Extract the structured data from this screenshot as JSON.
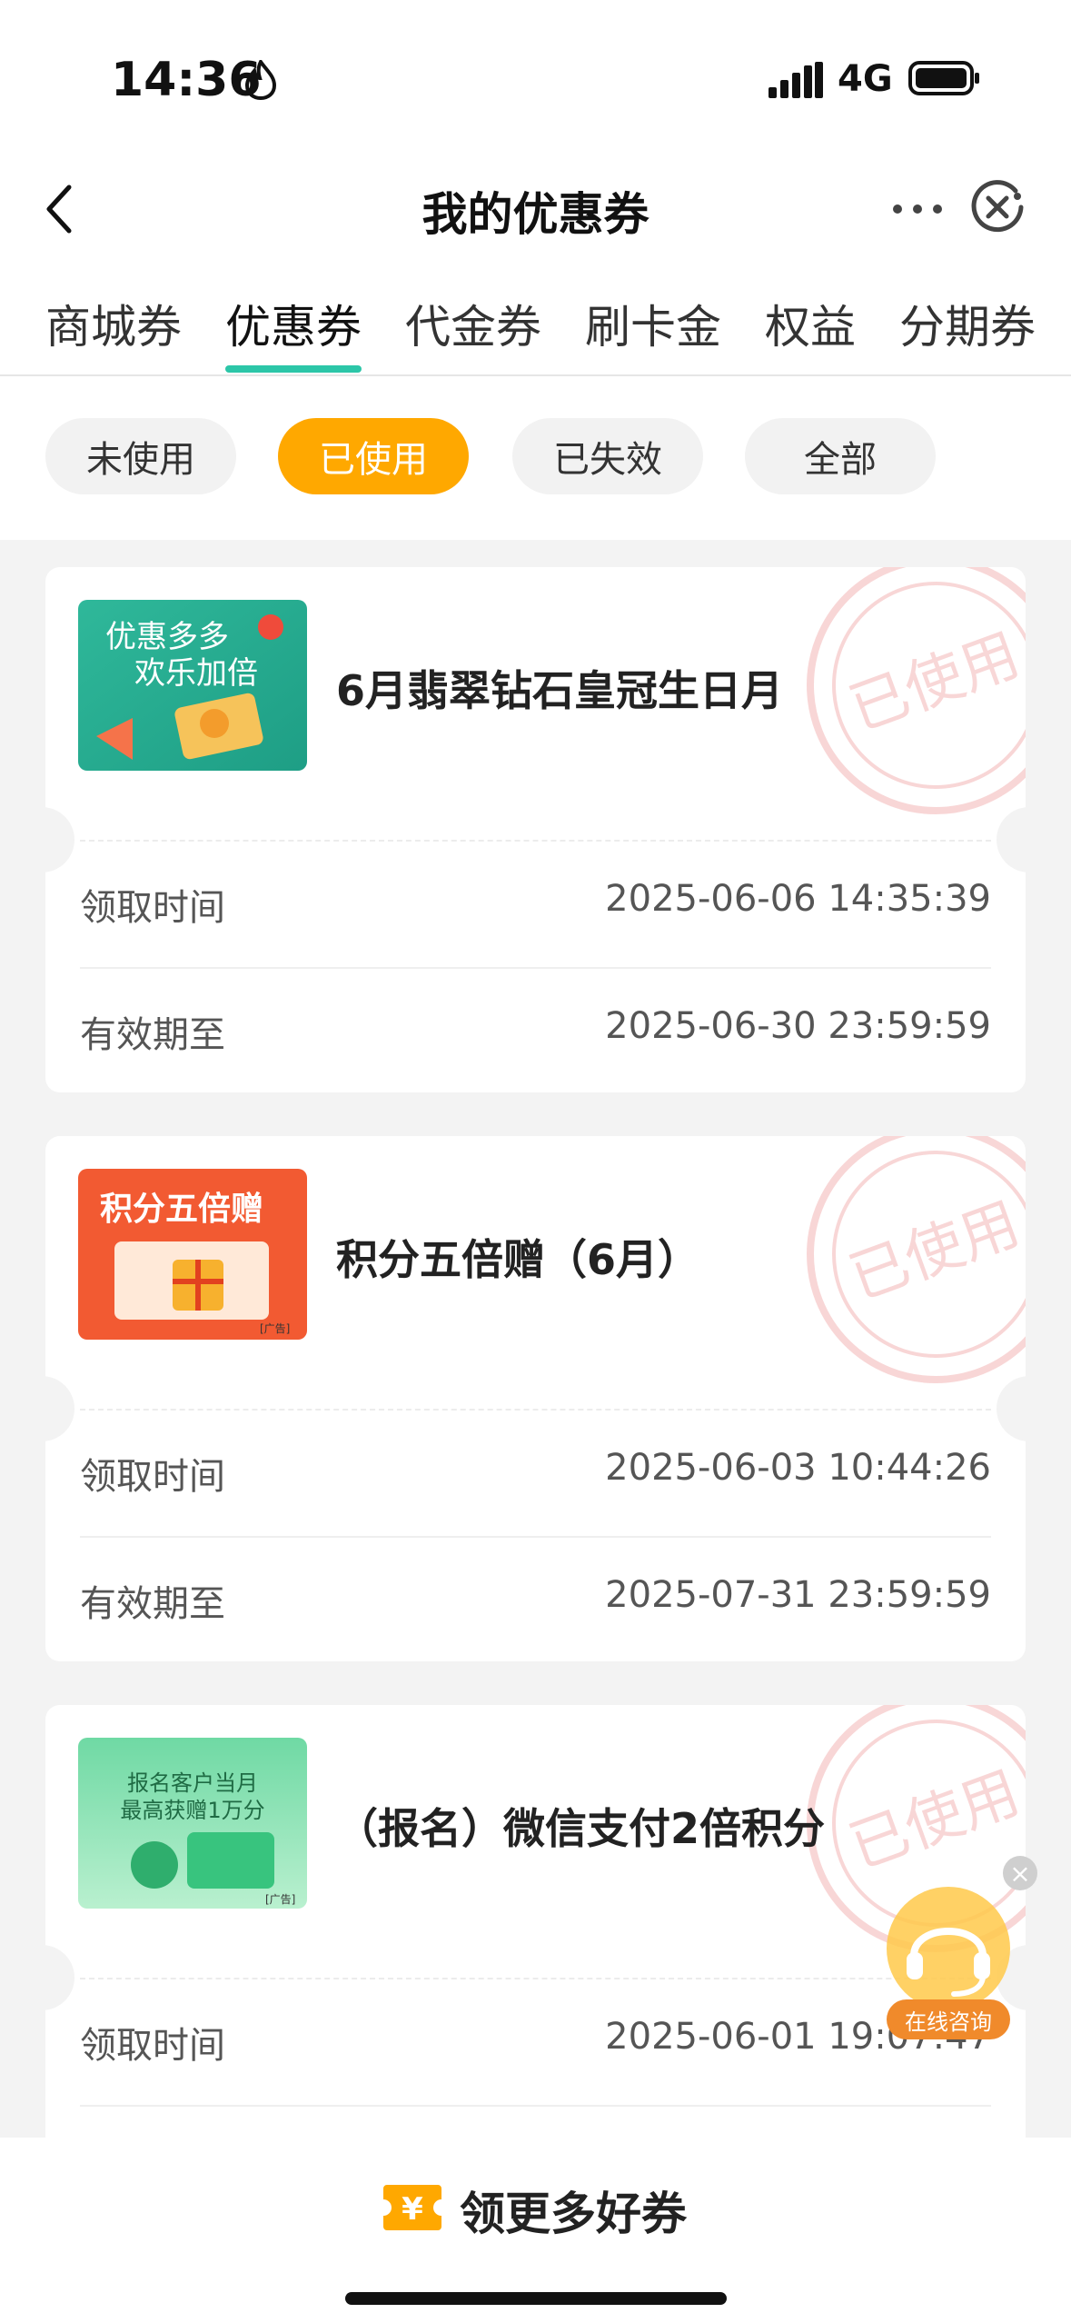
{
  "status_bar": {
    "time": "14:36",
    "network": "4G"
  },
  "nav": {
    "title": "我的优惠券"
  },
  "tabs": [
    {
      "label": "商城券"
    },
    {
      "label": "优惠券"
    },
    {
      "label": "代金券"
    },
    {
      "label": "刷卡金"
    },
    {
      "label": "权益"
    },
    {
      "label": "分期券"
    }
  ],
  "active_tab": "优惠券",
  "filters": [
    {
      "label": "未使用"
    },
    {
      "label": "已使用"
    },
    {
      "label": "已失效"
    },
    {
      "label": "全部"
    }
  ],
  "active_filter": "已使用",
  "coupons": [
    {
      "title": "6月翡翠钻石皇冠生日月",
      "thumb_text": [
        "优惠多多",
        "欢乐加倍"
      ],
      "stamp": "已使用",
      "received_label": "领取时间",
      "received_value": "2025-06-06 14:35:39",
      "valid_label": "有效期至",
      "valid_value": "2025-06-30 23:59:59"
    },
    {
      "title": "积分五倍赠（6月）",
      "thumb_text": [
        "积分五倍赠",
        "[广告]"
      ],
      "stamp": "已使用",
      "received_label": "领取时间",
      "received_value": "2025-06-03 10:44:26",
      "valid_label": "有效期至",
      "valid_value": "2025-07-31 23:59:59"
    },
    {
      "title": "（报名）微信支付2倍积分",
      "thumb_text": [
        "报名客户当月",
        "最高获赠1万分",
        "[广告]"
      ],
      "stamp": "已使用",
      "received_label": "领取时间",
      "received_value": "2025-06-01 19:07:47"
    }
  ],
  "float_button": {
    "label": "在线咨询",
    "close": "×"
  },
  "bottom_bar": {
    "label": "领更多好券",
    "icon_text": "¥"
  },
  "colors": {
    "accent": "#ffa800",
    "tab_underline": "#2cc6a8",
    "stamp": "#f3b6b6"
  }
}
